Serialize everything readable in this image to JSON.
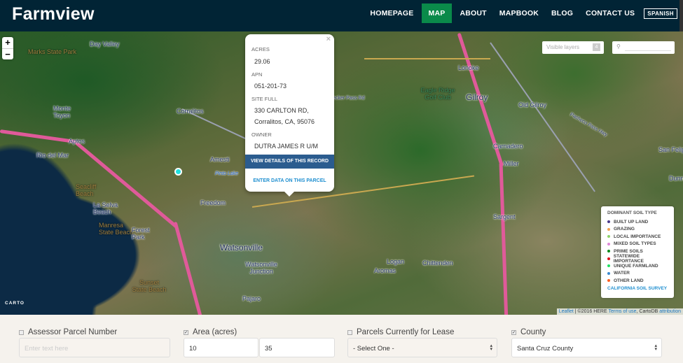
{
  "header": {
    "logo": "Farmview",
    "nav": [
      "HOMEPAGE",
      "MAP",
      "ABOUT",
      "MAPBOOK",
      "BLOG",
      "CONTACT US"
    ],
    "active_nav": "MAP",
    "spanish": "SPANISH",
    "brand_color": "#012435",
    "active_color": "#0a8a4a"
  },
  "map": {
    "zoom_in": "+",
    "zoom_out": "−",
    "visible_layers": {
      "placeholder": "Visible layers",
      "count": "4"
    },
    "search_icon": "magnifier-icon",
    "places": [
      "Marks State Park",
      "Day Valley",
      "Monte Toyon",
      "Aptos",
      "Rio del Mar",
      "Corralitos",
      "Amesti",
      "Seacliff Beach",
      "La Selva Beach",
      "Freedom",
      "Manresa State Beach",
      "Forest Park",
      "Watsonville",
      "Watsonville Junction",
      "Sunset State Beach",
      "Pajaro",
      "Aromas",
      "Logan",
      "Chittenden",
      "Lonoke",
      "Gilroy",
      "Old Gilroy",
      "Eagle Ridge Golf Club",
      "Carnadero",
      "Miller",
      "Sargent",
      "San Felipe",
      "Dunneville",
      "Pacheco Pass Hwy",
      "Hecker Pass Rd",
      "Pinto Lake"
    ],
    "popup": {
      "fields": [
        {
          "label": "ACRES",
          "value": "29.06"
        },
        {
          "label": "APN",
          "value": "051-201-73"
        },
        {
          "label": "SITE FULL",
          "value": "330 CARLTON RD,",
          "value2": "Corralitos, CA, 95076"
        },
        {
          "label": "OWNER",
          "value": "DUTRA JAMES R U/M"
        }
      ],
      "view_button": "VIEW DETAILS OF THIS RECORD",
      "enter_link": "ENTER DATA ON THIS PARCEL",
      "close": "×"
    },
    "legend": {
      "title": "DOMINANT SOIL TYPE",
      "items": [
        {
          "label": "BUILT UP LAND",
          "color": "#4b3a8c"
        },
        {
          "label": "GRAZING",
          "color": "#f4a050"
        },
        {
          "label": "LOCAL IMPORTANCE",
          "color": "#8fd46a"
        },
        {
          "label": "MIXED SOIL TYPES",
          "color": "#e088d8"
        },
        {
          "label": "PRIME SOILS",
          "color": "#0a8a1a"
        },
        {
          "label": "STATEWIDE IMPORTANCE",
          "color": "#e0101a"
        },
        {
          "label": "UNIQUE FARMLAND",
          "color": "#20e060"
        },
        {
          "label": "WATER",
          "color": "#3a8ad0"
        },
        {
          "label": "OTHER LAND",
          "color": "#ff6020"
        }
      ],
      "source": "CALIFORNIA SOIL SURVEY"
    },
    "carto": "CARTO",
    "attribution": {
      "leaflet": "Leaflet",
      "copyright": " | ©2016 HERE ",
      "terms": "Terms of use",
      "cartodb": ", CartoDB ",
      "attribution": "attribution"
    }
  },
  "filters": {
    "apn": {
      "label": "Assessor Parcel Number",
      "checked": false,
      "placeholder": "Enter text here"
    },
    "area": {
      "label": "Area (acres)",
      "checked": true,
      "min": "10",
      "max": "35"
    },
    "lease": {
      "label": "Parcels Currently for Lease",
      "checked": false,
      "value": "- Select One -"
    },
    "county": {
      "label": "County",
      "checked": true,
      "value": "Santa Cruz County"
    }
  }
}
